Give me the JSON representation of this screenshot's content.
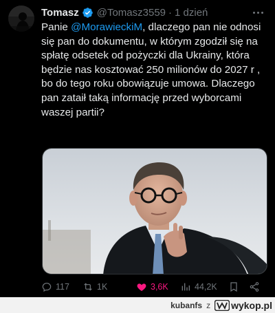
{
  "tweet": {
    "display_name": "Tomasz",
    "handle": "@Tomasz3559",
    "separator": "·",
    "time": "1 dzień",
    "text_before_mention": "Panie ",
    "mention": "@MorawieckiM",
    "text_after_mention": ", dlaczego pan nie odnosi się pan do dokumentu, w którym zgodził się na spłatę odsetek od pożyczki dla Ukrainy, która będzie nas kosztować 250 milionów do 2027 r , bo do tego roku obowiązuje umowa. Dlaczego pan zataił taką informację przed wyborcami waszej partii?",
    "icons": {
      "verified": "verified-badge-icon",
      "more": "more-icon",
      "avatar": "avatar-silhouette",
      "photo": "photo-man-in-suit"
    },
    "actions": {
      "replies": "117",
      "retweets": "1K",
      "likes": "3,6K",
      "views": "44,2K",
      "liked": true
    }
  },
  "watermark": {
    "user": "kubanfs",
    "z": "z",
    "site": "wykop.pl"
  },
  "colors": {
    "background": "#000000",
    "text": "#e7e9ea",
    "secondary": "#71767b",
    "accent": "#1d9bf0",
    "like": "#f91880",
    "footer_bg": "#f2f2f2"
  }
}
